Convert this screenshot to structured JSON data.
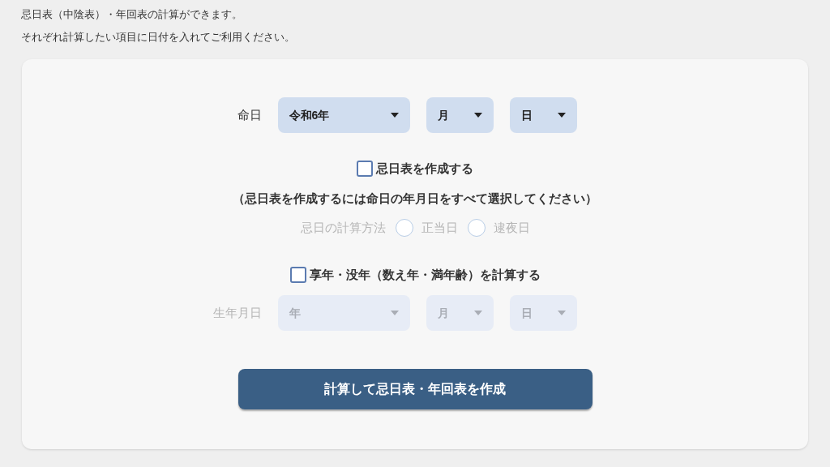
{
  "intro": [
    "忌日表（中陰表）・年回表の計算ができます。",
    "それぞれ計算したい項目に日付を入れてご利用ください。"
  ],
  "death_date": {
    "label": "命日",
    "disabled": false,
    "selects": [
      {
        "value": "令和6年"
      },
      {
        "value": "月"
      },
      {
        "value": "日"
      }
    ]
  },
  "memorial_table": {
    "label": "忌日表を作成する",
    "checked": false
  },
  "note": "（忌日表を作成するには命日の年月日をすべて選択してください）",
  "method": {
    "label": "忌日の計算方法",
    "disabled": true,
    "options": [
      {
        "label": "正当日",
        "selected": false
      },
      {
        "label": "逮夜日",
        "selected": false
      }
    ]
  },
  "age_calc": {
    "label": "享年・没年（数え年・満年齢）を計算する",
    "checked": false
  },
  "birth_date": {
    "label": "生年月日",
    "disabled": true,
    "selects": [
      {
        "value": "年"
      },
      {
        "value": "月"
      },
      {
        "value": "日"
      }
    ]
  },
  "submit": "計算して忌日表・年回表を作成"
}
